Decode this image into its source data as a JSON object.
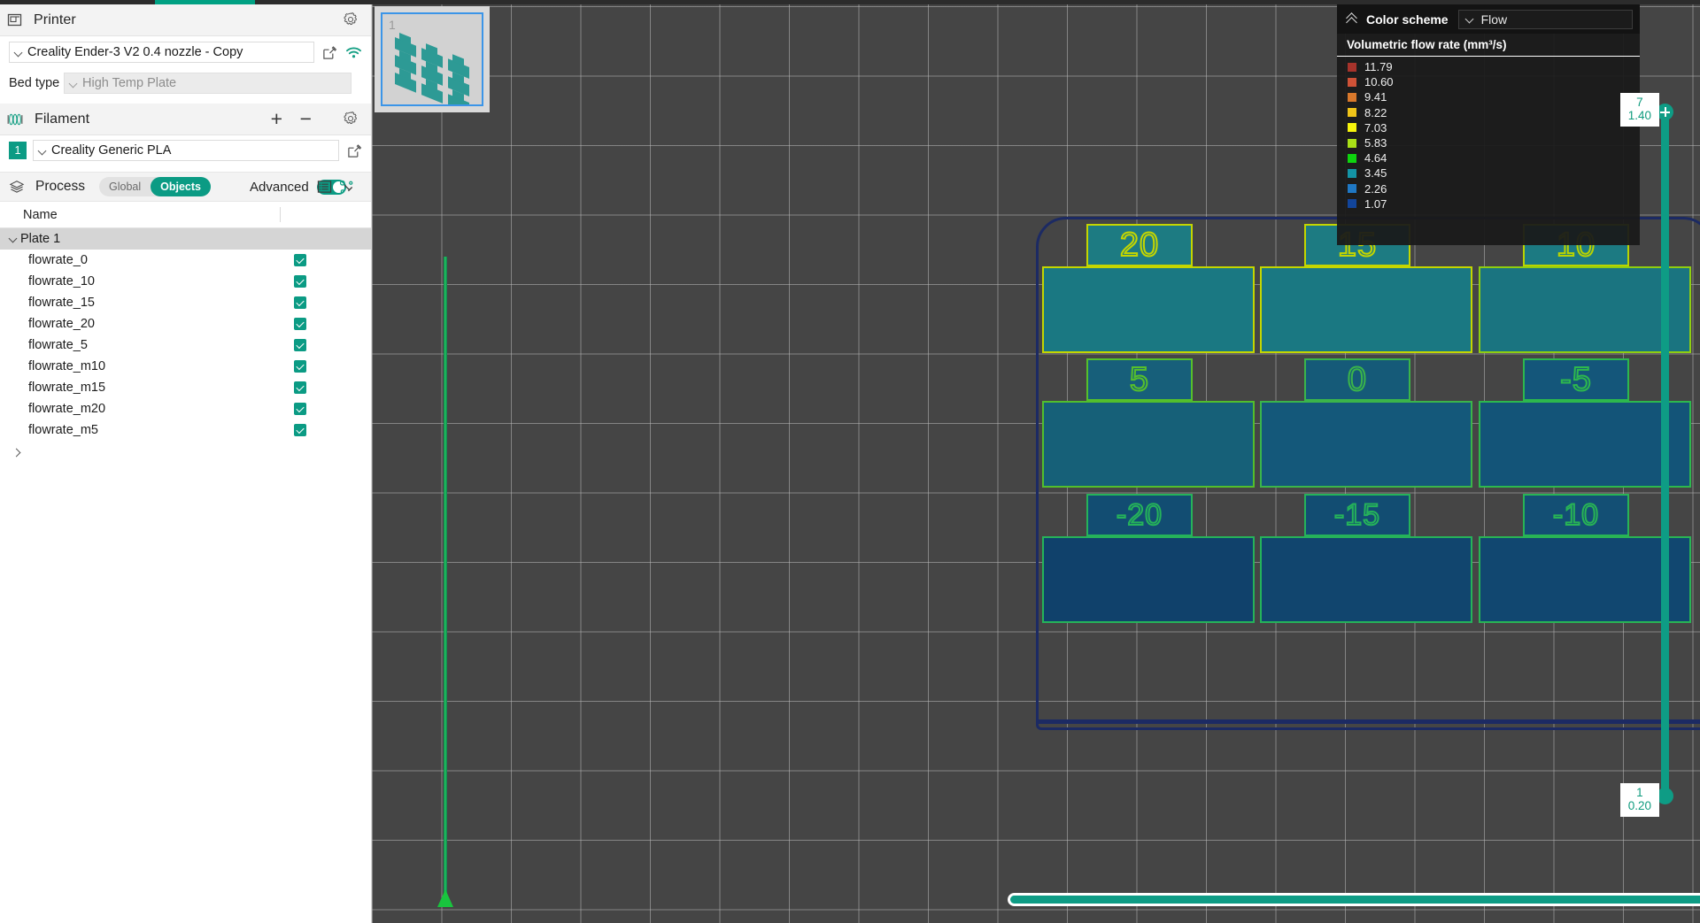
{
  "sidebar": {
    "printer": {
      "title": "Printer",
      "gear_icon": "gear-icon",
      "icon": "printer-icon",
      "preset": "Creality Ender-3 V2 0.4 nozzle - Copy",
      "edit_icon": "edit-icon",
      "wifi_icon": "wifi-icon",
      "bed_type_label": "Bed type",
      "bed_type_value": "High Temp Plate"
    },
    "filament": {
      "title": "Filament",
      "icon": "filament-spool-icon",
      "add_label": "+",
      "remove_label": "−",
      "gear_icon": "gear-icon",
      "index": "1",
      "preset": "Creality Generic PLA",
      "edit_icon": "edit-icon"
    },
    "process": {
      "title": "Process",
      "icon": "layers-icon",
      "segmented": [
        "Global",
        "Objects"
      ],
      "segmented_selected": "Objects",
      "advanced_label": "Advanced",
      "advanced_on": true,
      "list_icon": "list-view-icon",
      "settings_icon": "object-settings-icon"
    },
    "objects": {
      "column_name": "Name",
      "plate_label": "Plate 1",
      "items": [
        {
          "name": "flowrate_0",
          "checked": true
        },
        {
          "name": "flowrate_10",
          "checked": true
        },
        {
          "name": "flowrate_15",
          "checked": true
        },
        {
          "name": "flowrate_20",
          "checked": true
        },
        {
          "name": "flowrate_5",
          "checked": true
        },
        {
          "name": "flowrate_m10",
          "checked": true
        },
        {
          "name": "flowrate_m15",
          "checked": true
        },
        {
          "name": "flowrate_m20",
          "checked": true
        },
        {
          "name": "flowrate_m5",
          "checked": true
        }
      ]
    }
  },
  "viewport": {
    "thumbnail": {
      "number": "1",
      "name": "plate-thumbnail"
    },
    "background": "#454545",
    "plate_outline_color": "#1c2a63",
    "blocks": [
      {
        "label": "20",
        "tag_border": "#c4d600",
        "tag_fill": "#1d7b82",
        "body_border": "#c4d600",
        "body_fill": "#1a7882",
        "col": 0,
        "row": 0
      },
      {
        "label": "15",
        "tag_border": "#c4d600",
        "tag_fill": "#1d7b82",
        "body_border": "#c4d600",
        "body_fill": "#1a7882",
        "col": 1,
        "row": 0
      },
      {
        "label": "10",
        "tag_border": "#b9d400",
        "tag_fill": "#1c7a82",
        "body_border": "#8fce10",
        "body_fill": "#1a7480",
        "col": 2,
        "row": 0
      },
      {
        "label": "5",
        "tag_border": "#56c02b",
        "tag_fill": "#175f7a",
        "body_border": "#52bf2c",
        "body_fill": "#166078",
        "col": 0,
        "row": 1
      },
      {
        "label": "0",
        "tag_border": "#3bb54a",
        "tag_fill": "#155a78",
        "body_border": "#3bb54a",
        "body_fill": "#14587a",
        "col": 1,
        "row": 1
      },
      {
        "label": "-5",
        "tag_border": "#2db84d",
        "tag_fill": "#14567a",
        "body_border": "#2db84d",
        "body_fill": "#135478",
        "col": 2,
        "row": 1
      },
      {
        "label": "-20",
        "tag_border": "#25b35a",
        "tag_fill": "#124d72",
        "body_border": "#25b35a",
        "body_fill": "#10416b",
        "col": 0,
        "row": 2
      },
      {
        "label": "-15",
        "tag_border": "#25b35a",
        "tag_fill": "#124d72",
        "body_border": "#25b35a",
        "body_fill": "#11456e",
        "col": 1,
        "row": 2
      },
      {
        "label": "-10",
        "tag_border": "#28b455",
        "tag_fill": "#134f74",
        "body_border": "#28b455",
        "body_fill": "#114770",
        "col": 2,
        "row": 2
      }
    ],
    "extruder_path_color": "#22c55e"
  },
  "color_scheme": {
    "title": "Color scheme",
    "collapse_icon": "chevron-up-icon",
    "select_value": "Flow",
    "legend_title": "Volumetric flow rate (mm³/s)",
    "entries": [
      {
        "value": "11.79",
        "color": "#a7332b"
      },
      {
        "value": "10.60",
        "color": "#cf5237"
      },
      {
        "value": "9.41",
        "color": "#d9782b"
      },
      {
        "value": "8.22",
        "color": "#f0c419"
      },
      {
        "value": "7.03",
        "color": "#f7f40c"
      },
      {
        "value": "5.83",
        "color": "#a9e017"
      },
      {
        "value": "4.64",
        "color": "#0ed40e"
      },
      {
        "value": "3.45",
        "color": "#1494a6"
      },
      {
        "value": "2.26",
        "color": "#1f78c4"
      },
      {
        "value": "1.07",
        "color": "#12459b"
      }
    ]
  },
  "layer_slider": {
    "top_layer": "7",
    "top_height": "1.40",
    "bottom_layer": "1",
    "bottom_height": "0.20",
    "accent": "#0e9c85"
  },
  "move_slider": {
    "value": "1803",
    "accent": "#0e9c85"
  }
}
